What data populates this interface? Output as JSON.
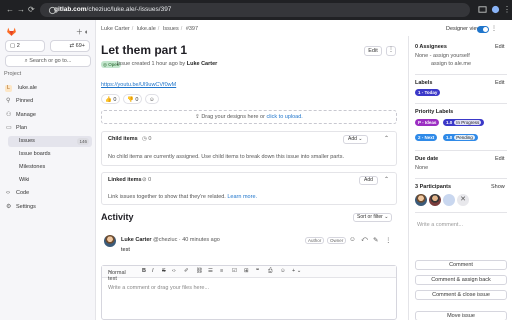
{
  "browser": {
    "url_host": "gitlab.com",
    "url_path": "/cheziuc/luke.ale/-/issues/397"
  },
  "sidebar": {
    "counter_badge": "2",
    "merge_badge": "69+",
    "search": "Search or go to...",
    "project_label": "Project",
    "project_initial": "L",
    "project_name": "luke.ale",
    "items": {
      "pinned": "Pinned",
      "manage": "Manage",
      "plan": "Plan",
      "issues": "Issues",
      "issues_count": "146",
      "issue_boards": "Issue boards",
      "milestones": "Milestones",
      "wiki": "Wiki",
      "code": "Code",
      "settings": "Settings"
    }
  },
  "breadcrumb": {
    "owner": "Luke Carter",
    "project": "luke.ale",
    "section": "Issues",
    "issue": "#397"
  },
  "header": {
    "designer_view": "Designer view",
    "toggle_on": true
  },
  "issue": {
    "title": "Let them part 1",
    "edit": "Edit",
    "status": "Open",
    "created": "Issue created 1 hour ago by",
    "author": "Luke Carter",
    "link": "https://youtu.be/Ul9uwCVf0wM",
    "reactions": {
      "thumbs_up": "0",
      "thumbs_down": "0"
    },
    "dropzone_text": "Drag your designs here or",
    "dropzone_link": "click to upload."
  },
  "child_items": {
    "title": "Child items",
    "count": "0",
    "add": "Add",
    "empty": "No child items are currently assigned. Use child items to break down this issue into smaller parts."
  },
  "linked_items": {
    "title": "Linked items",
    "count": "0",
    "add": "Add",
    "empty": "Link issues together to show that they're related.",
    "learn_more": "Learn more."
  },
  "activity": {
    "title": "Activity",
    "sort": "Sort or filter",
    "comment": {
      "author": "Luke Carter",
      "handle": "@cheziuc",
      "time": "· 40 minutes ago",
      "author_tag": "Author",
      "owner_tag": "Owner",
      "text": "test"
    }
  },
  "editor": {
    "format": "Normal text",
    "placeholder": "Write a comment or drag your files here..."
  },
  "right_sidebar": {
    "assignees_title": "0 Assignees",
    "assignees_none": "None - assign yourself",
    "assign_me": "assign to ale.me",
    "labels_title": "Labels",
    "labels": [
      {
        "key": "1 - Today",
        "value": "",
        "color": "#3b38c8"
      },
      {
        "key": "P - Ideas",
        "value": "",
        "color": "#9b2ec2"
      },
      {
        "key": "1.0",
        "value": "In Progress",
        "color": "#3b38c8"
      },
      {
        "key": "2 - Next",
        "value": "",
        "color": "#2f8ae8"
      },
      {
        "key": "1.0",
        "value": "Pending",
        "color": "#2f8ae8"
      }
    ],
    "priority_title": "Priority Labels",
    "due_title": "Due date",
    "due_value": "None",
    "participants_title": "3 Participants",
    "show": "Show",
    "edit": "Edit",
    "comment_placeholder": "Write a comment...",
    "btn_comment": "Comment",
    "btn_assign_back": "Comment & assign back",
    "btn_close": "Comment & close issue",
    "btn_move": "Move issue"
  }
}
